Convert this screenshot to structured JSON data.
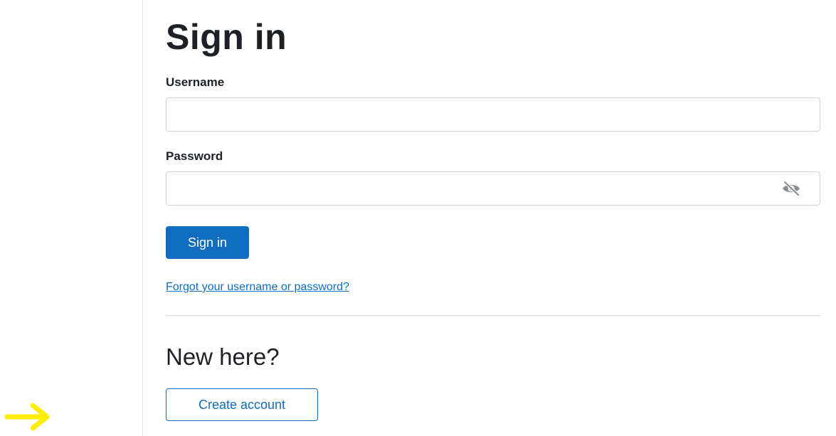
{
  "login": {
    "title": "Sign in",
    "username_label": "Username",
    "username_value": "",
    "password_label": "Password",
    "password_value": "",
    "password_toggle_icon": "eye-slash-icon",
    "signin_label": "Sign in",
    "forgot_link": "Forgot your username or password?"
  },
  "signup": {
    "heading": "New here?",
    "create_label": "Create account"
  },
  "annotation": {
    "arrow_icon": "arrow-right-icon",
    "arrow_color": "#ffee00"
  },
  "colors": {
    "primary": "#0f6cbf",
    "text": "#1d2125",
    "border": "#d0d4d8"
  }
}
